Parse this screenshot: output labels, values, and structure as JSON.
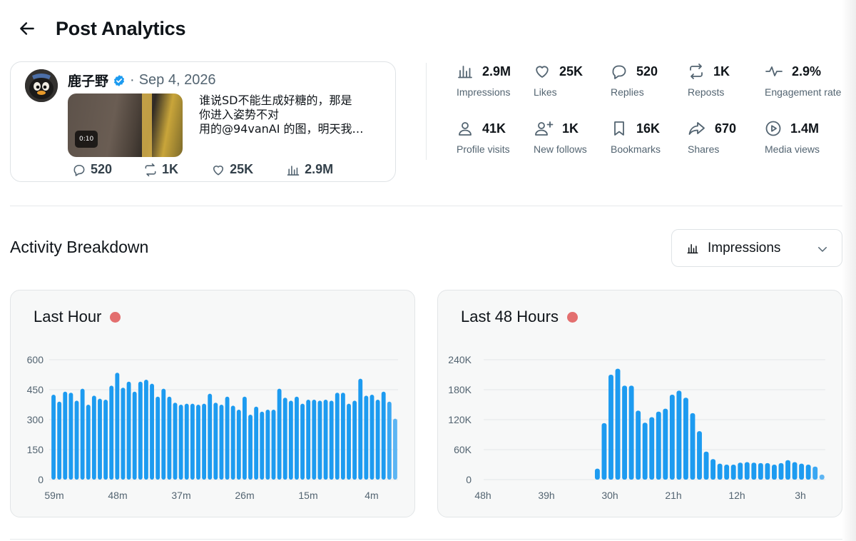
{
  "header": {
    "title": "Post Analytics"
  },
  "post": {
    "author": "鹿子野",
    "separator": "·",
    "date": "Sep 4, 2026",
    "video_duration": "0:10",
    "text_lines": [
      "谁说SD不能生成好糖的，那是",
      "你进入姿势不对",
      "用的@94vanAI 的图，明天我…"
    ],
    "stats": {
      "replies": "520",
      "reposts": "1K",
      "likes": "25K",
      "views": "2.9M"
    }
  },
  "metrics": [
    {
      "icon": "bar-chart-icon",
      "value": "2.9M",
      "label": "Impressions"
    },
    {
      "icon": "heart-icon",
      "value": "25K",
      "label": "Likes"
    },
    {
      "icon": "reply-icon",
      "value": "520",
      "label": "Replies"
    },
    {
      "icon": "repost-icon",
      "value": "1K",
      "label": "Reposts"
    },
    {
      "icon": "pulse-icon",
      "value": "2.9%",
      "label": "Engagement rate"
    },
    {
      "icon": "profile-icon",
      "value": "41K",
      "label": "Profile visits"
    },
    {
      "icon": "add-user-icon",
      "value": "1K",
      "label": "New follows"
    },
    {
      "icon": "bookmark-icon",
      "value": "16K",
      "label": "Bookmarks"
    },
    {
      "icon": "share-icon",
      "value": "670",
      "label": "Shares"
    },
    {
      "icon": "play-icon",
      "value": "1.4M",
      "label": "Media views"
    }
  ],
  "activity": {
    "title": "Activity Breakdown",
    "dropdown_selected": "Impressions"
  },
  "colors": {
    "bar": "#1d9bf0",
    "bar_light": "#5db5f3",
    "live_dot": "#e36f6f",
    "text_primary": "#0f1419",
    "text_secondary": "#536471"
  },
  "chart_data": [
    {
      "type": "bar",
      "title": "Last Hour",
      "xlabel": "",
      "ylabel": "",
      "ylim": [
        0,
        600
      ],
      "y_ticks": [
        "0",
        "150",
        "300",
        "450",
        "600"
      ],
      "x_tick_labels": [
        "59m",
        "48m",
        "37m",
        "26m",
        "15m",
        "4m"
      ],
      "grid": true,
      "values": [
        425,
        390,
        440,
        435,
        395,
        455,
        375,
        420,
        405,
        400,
        470,
        535,
        460,
        490,
        440,
        490,
        500,
        480,
        415,
        455,
        415,
        385,
        375,
        380,
        380,
        375,
        380,
        430,
        385,
        375,
        415,
        370,
        350,
        415,
        325,
        365,
        340,
        350,
        350,
        455,
        410,
        395,
        415,
        380,
        400,
        400,
        395,
        400,
        395,
        435,
        435,
        380,
        395,
        505,
        420,
        425,
        400,
        440,
        390,
        305
      ]
    },
    {
      "type": "bar",
      "title": "Last 48 Hours",
      "xlabel": "",
      "ylabel": "",
      "ylim": [
        0,
        240000
      ],
      "y_ticks": [
        "0",
        "60K",
        "120K",
        "180K",
        "240K"
      ],
      "x_tick_labels": [
        "48h",
        "39h",
        "30h",
        "21h",
        "12h",
        "3h"
      ],
      "grid": true,
      "values": [
        0,
        0,
        0,
        0,
        0,
        0,
        0,
        0,
        0,
        0,
        0,
        0,
        0,
        0,
        0,
        0,
        22000,
        113000,
        210000,
        222000,
        188000,
        188000,
        138000,
        114000,
        125000,
        136000,
        142000,
        170000,
        178000,
        164000,
        133000,
        97000,
        56000,
        41000,
        32000,
        30000,
        30000,
        34000,
        35000,
        34000,
        33000,
        33000,
        30000,
        33000,
        39000,
        35000,
        32000,
        30000,
        26000,
        10000
      ]
    }
  ]
}
